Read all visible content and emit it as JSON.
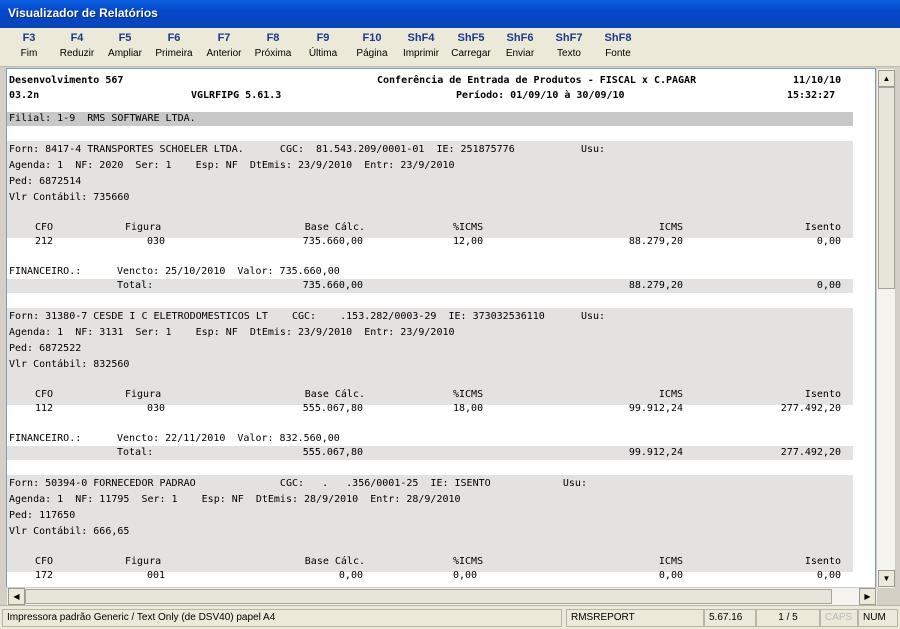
{
  "window": {
    "title": "Visualizador de Relatórios"
  },
  "toolbar": [
    {
      "key": "F3",
      "label": "Fim"
    },
    {
      "key": "F4",
      "label": "Reduzir"
    },
    {
      "key": "F5",
      "label": "Ampliar"
    },
    {
      "key": "F6",
      "label": "Primeira"
    },
    {
      "key": "F7",
      "label": "Anterior"
    },
    {
      "key": "F8",
      "label": "Próxima"
    },
    {
      "key": "F9",
      "label": "Última"
    },
    {
      "key": "F10",
      "label": "Página"
    },
    {
      "key": "ShF4",
      "label": "Imprimir"
    },
    {
      "key": "ShF5",
      "label": "Carregar"
    },
    {
      "key": "ShF6",
      "label": "Enviar"
    },
    {
      "key": "ShF7",
      "label": "Texto"
    },
    {
      "key": "ShF8",
      "label": "Fonte"
    }
  ],
  "report": {
    "header": {
      "company": "Desenvolvimento 567",
      "version_code": "03.2n",
      "program": "VGLRFIPG 5.61.3",
      "title": "Conferência de Entrada de Produtos - FISCAL x C.PAGAR",
      "period": "Período: 01/09/10 à 30/09/10",
      "date": "11/10/10",
      "time": "15:32:27"
    },
    "filial": "Filial: 1-9  RMS SOFTWARE LTDA.",
    "columns": {
      "cfo": "CFO",
      "figura": "Figura",
      "base": "Base Cálc.",
      "pct": "%ICMS",
      "icms": "ICMS",
      "isento": "Isento"
    },
    "total_label": "Total:",
    "financeiro_label": "FINANCEIRO.:",
    "blocks": [
      {
        "forn": "Forn: 8417-4 TRANSPORTES SCHOELER LTDA.      CGC:  81.543.209/0001-01  IE: 251875776           Usu:",
        "agenda": "Agenda: 1  NF: 2020  Ser: 1    Esp: NF  DtEmis: 23/9/2010  Entr: 23/9/2010",
        "ped": "Ped: 6872514",
        "vlr": "Vlr Contábil: 735660",
        "row": {
          "cfo": "212",
          "figura": "030",
          "base": "735.660,00",
          "pct": "12,00",
          "icms": "88.279,20",
          "isento": "0,00"
        },
        "financeiro": "Vencto: 25/10/2010  Valor: 735.660,00",
        "total": {
          "base": "735.660,00",
          "icms": "88.279,20",
          "isento": "0,00"
        }
      },
      {
        "forn": "Forn: 31380-7 CESDE I C ELETRODOMESTICOS LT    CGC:    .153.282/0003-29  IE: 373032536110      Usu:",
        "agenda": "Agenda: 1  NF: 3131  Ser: 1    Esp: NF  DtEmis: 23/9/2010  Entr: 23/9/2010",
        "ped": "Ped: 6872522",
        "vlr": "Vlr Contábil: 832560",
        "row": {
          "cfo": "112",
          "figura": "030",
          "base": "555.067,80",
          "pct": "18,00",
          "icms": "99.912,24",
          "isento": "277.492,20"
        },
        "financeiro": "Vencto: 22/11/2010  Valor: 832.560,00",
        "total": {
          "base": "555.067,80",
          "icms": "99.912,24",
          "isento": "277.492,20"
        }
      },
      {
        "forn": "Forn: 50394-0 FORNECEDOR PADRAO              CGC:   .   .356/0001-25  IE: ISENTO            Usu:",
        "agenda": "Agenda: 1  NF: 11795  Ser: 1    Esp: NF  DtEmis: 28/9/2010  Entr: 28/9/2010",
        "ped": "Ped: 117650",
        "vlr": "Vlr Contábil: 666,65",
        "row": {
          "cfo": "172",
          "figura": "001",
          "base": "0,00",
          "pct": "0,00",
          "icms": "0,00",
          "isento": "0,00"
        }
      }
    ]
  },
  "statusbar": {
    "printer": "Impressora padrão Generic / Text Only (de DSV40) papel A4",
    "app": "RMSREPORT",
    "version": "5.67.16",
    "page": "1 / 5",
    "caps": "CAPS",
    "num": "NUM"
  }
}
